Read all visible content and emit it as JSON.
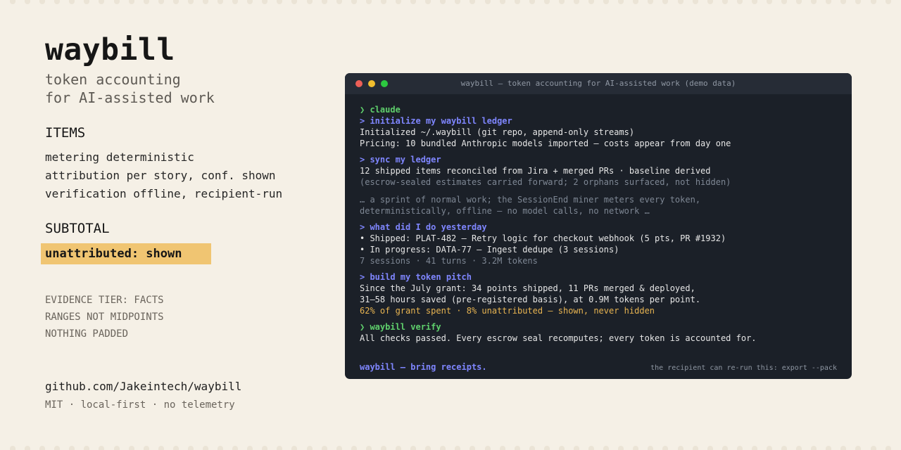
{
  "brand": {
    "name": "waybill",
    "tagline_lines": [
      "token accounting",
      "for AI-assisted work"
    ]
  },
  "items": {
    "heading": "ITEMS",
    "lines": [
      "metering deterministic",
      "attribution per story, conf. shown",
      "verification offline, recipient-run"
    ]
  },
  "subtotal": {
    "heading": "SUBTOTAL",
    "highlight": "unattributed: shown"
  },
  "evidence": {
    "lines": [
      "EVIDENCE TIER: FACTS",
      "RANGES NOT MIDPOINTS",
      "NOTHING PADDED"
    ]
  },
  "repo": {
    "link": "github.com/Jakeintech/waybill",
    "meta": "MIT · local-first · no telemetry"
  },
  "terminal": {
    "title": "waybill — token accounting for AI-assisted work (demo data)",
    "launch": "❯ claude",
    "blocks": [
      {
        "command": "initialize my waybill ledger",
        "output": [
          "Initialized ~/.waybill (git repo, append-only streams)",
          "Pricing: 10 bundled Anthropic models imported — costs appear from day one"
        ]
      },
      {
        "command": "sync my ledger",
        "output": [
          "12 shipped items reconciled from Jira + merged PRs · baseline derived"
        ],
        "muted": [
          "(escrow-sealed estimates carried forward; 2 orphans surfaced, not hidden)"
        ]
      }
    ],
    "narration": [
      "… a sprint of normal work; the SessionEnd miner meters every token,",
      "deterministically, offline — no model calls, no network …"
    ],
    "blocks_after": [
      {
        "command": "what did I do yesterday",
        "output": [
          "• Shipped: PLAT-482 — Retry logic for checkout webhook (5 pts, PR #1932)",
          "• In progress: DATA-77 — Ingest dedupe (3 sessions)"
        ],
        "muted": [
          "7 sessions · 41 turns · 3.2M tokens"
        ]
      },
      {
        "command": "build my token pitch",
        "output": [
          "Since the July grant: 34 points shipped, 11 PRs merged & deployed,",
          "31–58 hours saved (pre-registered basis), at 0.9M tokens per point."
        ],
        "warn": "62% of grant spent · 8% unattributed — shown, never hidden"
      }
    ],
    "verify": {
      "command": "❯ waybill verify",
      "output": "All checks passed. Every escrow seal recomputes; every token is accounted for."
    },
    "footer_tag": "waybill — bring receipts.",
    "footer_hint": "the recipient can re-run this: export --pack"
  },
  "colors": {
    "background": "#f5f0e6",
    "highlight": "#f0c572",
    "terminal_bg": "#1b2028",
    "prompt_green": "#5fd06c",
    "command_blue": "#7f86ff",
    "warning_amber": "#e8b451"
  }
}
